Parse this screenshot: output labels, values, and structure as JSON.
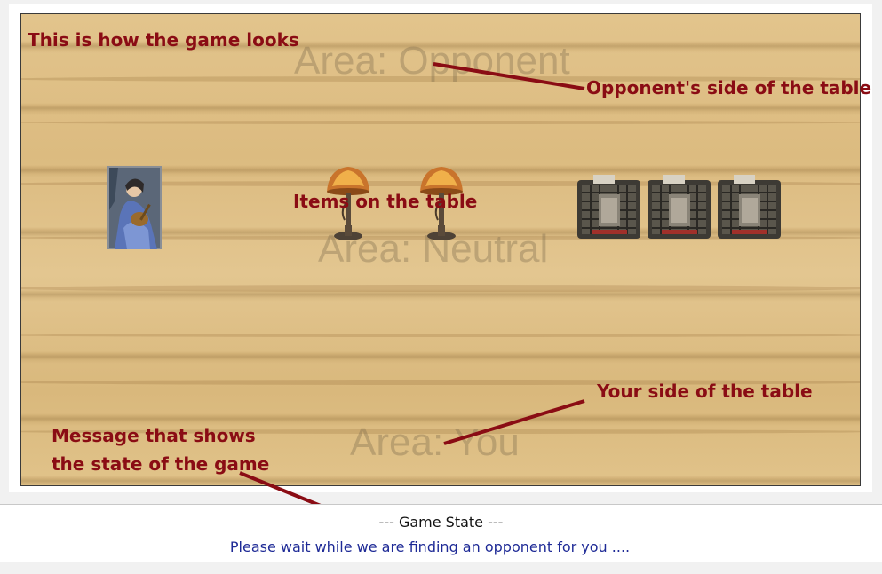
{
  "table": {
    "areas": {
      "opponent": "Area: Opponent",
      "neutral": "Area: Neutral",
      "you": "Area: You"
    },
    "items": {
      "card": "painting-card",
      "lamps": [
        "mushroom-lamp",
        "mushroom-lamp"
      ],
      "crates": [
        "crate",
        "crate",
        "crate"
      ]
    }
  },
  "annotations": {
    "how_it_looks": "This is how the game looks",
    "opponent_side": "Opponent's side of the table",
    "items_on_table": "Items on the table",
    "your_side": "Your side of the table",
    "message_state": "Message that shows the state of the game"
  },
  "colors": {
    "annotation": "#8a0c14",
    "status_message": "#1e2a96",
    "wood": "#e0c28a"
  },
  "footer": {
    "title": "--- Game State ---",
    "message": "Please wait while we are finding an opponent for you ...."
  }
}
